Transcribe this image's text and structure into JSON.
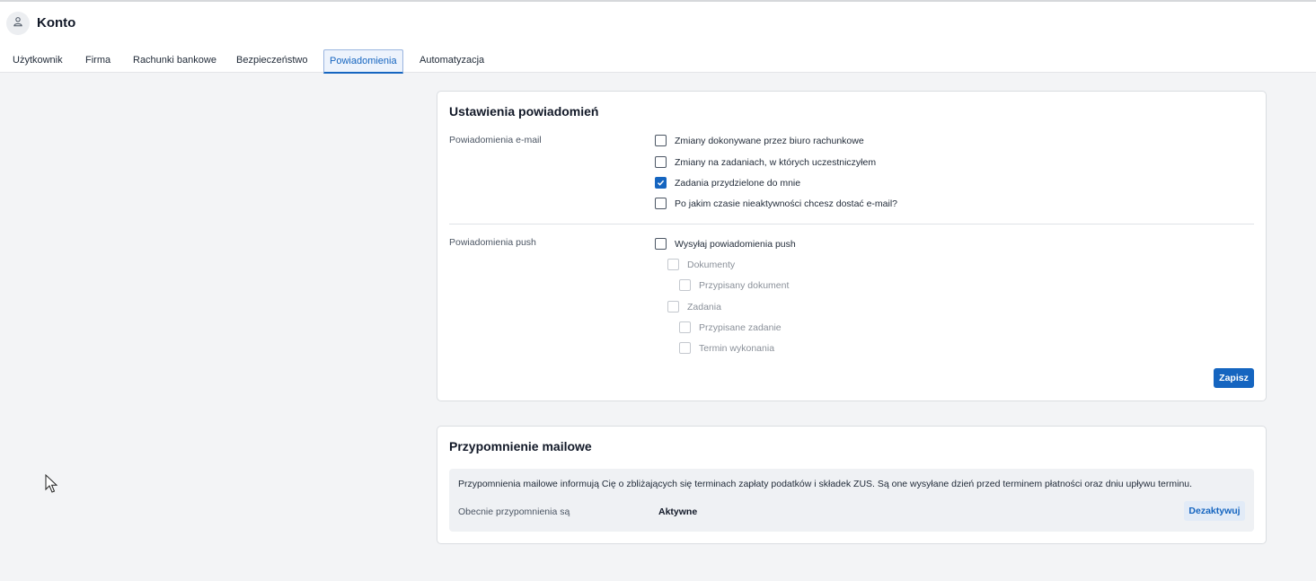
{
  "header": {
    "title": "Konto",
    "avatar_icon": "user-icon"
  },
  "tabs": [
    {
      "label": "Użytkownik",
      "active": false
    },
    {
      "label": "Firma",
      "active": false
    },
    {
      "label": "Rachunki bankowe",
      "active": false
    },
    {
      "label": "Bezpieczeństwo",
      "active": false
    },
    {
      "label": "Powiadomienia",
      "active": true
    },
    {
      "label": "Automatyzacja",
      "active": false
    }
  ],
  "notifications": {
    "title": "Ustawienia powiadomień",
    "email": {
      "label": "Powiadomienia e-mail",
      "options": [
        {
          "label": "Zmiany dokonywane przez biuro rachunkowe",
          "checked": false
        },
        {
          "label": "Zmiany na zadaniach, w których uczestniczyłem",
          "checked": false
        },
        {
          "label": "Zadania przydzielone do mnie",
          "checked": true
        },
        {
          "label": "Po jakim czasie nieaktywności chcesz dostać e-mail?",
          "checked": false
        }
      ]
    },
    "push": {
      "label": "Powiadomienia push",
      "options": [
        {
          "label": "Wysyłaj powiadomienia push",
          "checked": false,
          "disabled": false
        },
        {
          "label": "Dokumenty",
          "checked": false,
          "disabled": true
        },
        {
          "label": "Przypisany dokument",
          "checked": false,
          "disabled": true
        },
        {
          "label": "Zadania",
          "checked": false,
          "disabled": true
        },
        {
          "label": "Przypisane zadanie",
          "checked": false,
          "disabled": true
        },
        {
          "label": "Termin wykonania",
          "checked": false,
          "disabled": true
        }
      ]
    },
    "save_label": "Zapisz"
  },
  "reminder": {
    "title": "Przypomnienie mailowe",
    "info": "Przypomnienia mailowe informują Cię o zbliżających się terminach zapłaty podatków i składek ZUS. Są one wysyłane dzień przed terminem płatności oraz dniu upływu terminu.",
    "status_label": "Obecnie przypomnienia są",
    "status_value": "Aktywne",
    "deactivate_label": "Dezaktywuj"
  },
  "colors": {
    "accent": "#1565c0",
    "background": "#f3f4f6",
    "card": "#ffffff"
  }
}
